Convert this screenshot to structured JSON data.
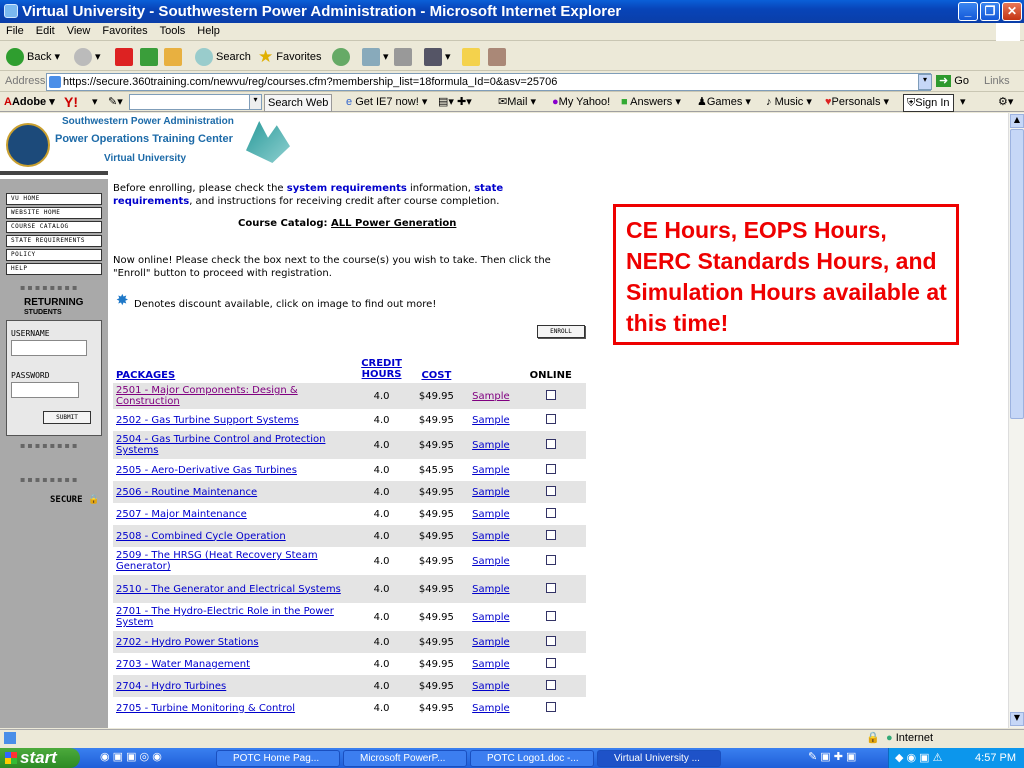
{
  "window": {
    "title": "Virtual University - Southwestern Power Administration - Microsoft Internet Explorer"
  },
  "menu": [
    "File",
    "Edit",
    "View",
    "Favorites",
    "Tools",
    "Help"
  ],
  "toolbar": {
    "back": "Back",
    "search": "Search",
    "favorites": "Favorites"
  },
  "address": {
    "label": "Address",
    "url": "https://secure.360training.com/newvu/reg/courses.cfm?membership_list=18formula_Id=0&asv=25706",
    "go": "Go",
    "links": "Links"
  },
  "yahoo": {
    "adobe": "Adobe",
    "search_web": "Search Web",
    "ie7": "Get IE7 now!",
    "mail": "Mail",
    "my_yahoo": "My Yahoo!",
    "answers": "Answers",
    "games": "Games",
    "music": "Music",
    "personals": "Personals",
    "sign_in": "Sign In"
  },
  "header": {
    "line1": "Southwestern Power Administration",
    "line2": "Power Operations Training Center",
    "line3": "Virtual University"
  },
  "sidebar": {
    "nav": [
      "VU HOME",
      "WEBSITE HOME",
      "COURSE CATALOG",
      "STATE REQUIREMENTS",
      "POLICY",
      "HELP"
    ],
    "returning": "RETURNING",
    "students": "STUDENTS",
    "username": "USERNAME",
    "password": "PASSWORD",
    "submit": "SUBMIT",
    "secure": "SECURE"
  },
  "content": {
    "intro_a": "Before enrolling, please check the ",
    "sysreq": "system requirements",
    "intro_b": " information, ",
    "statereq": "state requirements",
    "intro_c": ", and instructions for receiving credit after course completion.",
    "catalog_label": "Course Catalog: ",
    "catalog_name": "ALL Power Generation",
    "online_note": "Now online! Please check the box next to the course(s) you wish to take. Then click the \"Enroll\" button to proceed with registration.",
    "discount_note": "Denotes discount available, click on image to find out more!",
    "enroll": "ENROLL"
  },
  "table": {
    "headers": {
      "packages": "PACKAGES",
      "credit": "CREDIT",
      "hours": "HOURS",
      "cost": "COST",
      "online": "ONLINE"
    },
    "rows": [
      {
        "name": "2501 - Major Components: Design & Construction",
        "hours": "4.0",
        "cost": "$49.95",
        "sample": "Sample"
      },
      {
        "name": "2502 - Gas Turbine Support Systems",
        "hours": "4.0",
        "cost": "$49.95",
        "sample": "Sample"
      },
      {
        "name": "2504 - Gas Turbine Control and Protection Systems",
        "hours": "4.0",
        "cost": "$49.95",
        "sample": "Sample"
      },
      {
        "name": "2505 - Aero-Derivative Gas Turbines",
        "hours": "4.0",
        "cost": "$45.95",
        "sample": "Sample"
      },
      {
        "name": "2506 - Routine Maintenance",
        "hours": "4.0",
        "cost": "$49.95",
        "sample": "Sample"
      },
      {
        "name": "2507 - Major Maintenance",
        "hours": "4.0",
        "cost": "$49.95",
        "sample": "Sample"
      },
      {
        "name": "2508 - Combined Cycle Operation",
        "hours": "4.0",
        "cost": "$49.95",
        "sample": "Sample"
      },
      {
        "name": "2509 - The HRSG (Heat Recovery Steam Generator)",
        "hours": "4.0",
        "cost": "$49.95",
        "sample": "Sample"
      },
      {
        "name": "2510 - The Generator and Electrical Systems",
        "hours": "4.0",
        "cost": "$49.95",
        "sample": "Sample"
      },
      {
        "name": "2701 - The Hydro-Electric Role in the Power System",
        "hours": "4.0",
        "cost": "$49.95",
        "sample": "Sample"
      },
      {
        "name": "2702 - Hydro Power Stations",
        "hours": "4.0",
        "cost": "$49.95",
        "sample": "Sample"
      },
      {
        "name": "2703 - Water Management",
        "hours": "4.0",
        "cost": "$49.95",
        "sample": "Sample"
      },
      {
        "name": "2704 - Hydro Turbines",
        "hours": "4.0",
        "cost": "$49.95",
        "sample": "Sample"
      },
      {
        "name": "2705 - Turbine Monitoring & Control",
        "hours": "4.0",
        "cost": "$49.95",
        "sample": "Sample"
      }
    ]
  },
  "callout": {
    "text": "CE Hours, EOPS Hours, NERC Standards Hours, and Simulation Hours available at this time!"
  },
  "status": {
    "zone": "Internet"
  },
  "taskbar": {
    "start": "start",
    "tasks": [
      "POTC Home Pag...",
      "Microsoft PowerP...",
      "POTC Logo1.doc -...",
      "Virtual University ..."
    ],
    "clock": "4:57 PM"
  }
}
